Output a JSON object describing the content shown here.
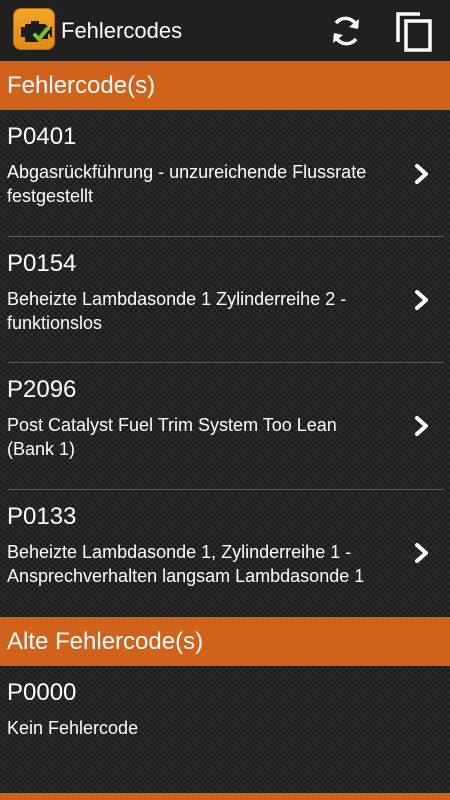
{
  "appbar": {
    "title": "Fehlercodes",
    "logo_icon": "check-engine-icon",
    "actions": [
      {
        "icon": "refresh-icon"
      },
      {
        "icon": "copy-icon"
      }
    ]
  },
  "sections": [
    {
      "header": "Fehlercode(s)",
      "items": [
        {
          "code": "P0401",
          "description": "Abgasrückführung - unzureichende Flussrate festgestellt"
        },
        {
          "code": "P0154",
          "description": "Beheizte Lambdasonde 1 Zylinderreihe 2 - funktionslos"
        },
        {
          "code": "P2096",
          "description": "Post Catalyst Fuel Trim System Too Lean (Bank 1)"
        },
        {
          "code": "P0133",
          "description": "Beheizte Lambdasonde 1, Zylinderreihe 1 - Ansprechverhalten langsam Lambdasonde 1"
        }
      ]
    },
    {
      "header": "Alte Fehlercode(s)",
      "items": [
        {
          "code": "P0000",
          "description": "Kein Fehlercode"
        }
      ]
    }
  ],
  "colors": {
    "accent": "#d0621c",
    "appbar": "#202020",
    "divider": "#5a5a5a",
    "logo": "#f39c1f"
  }
}
